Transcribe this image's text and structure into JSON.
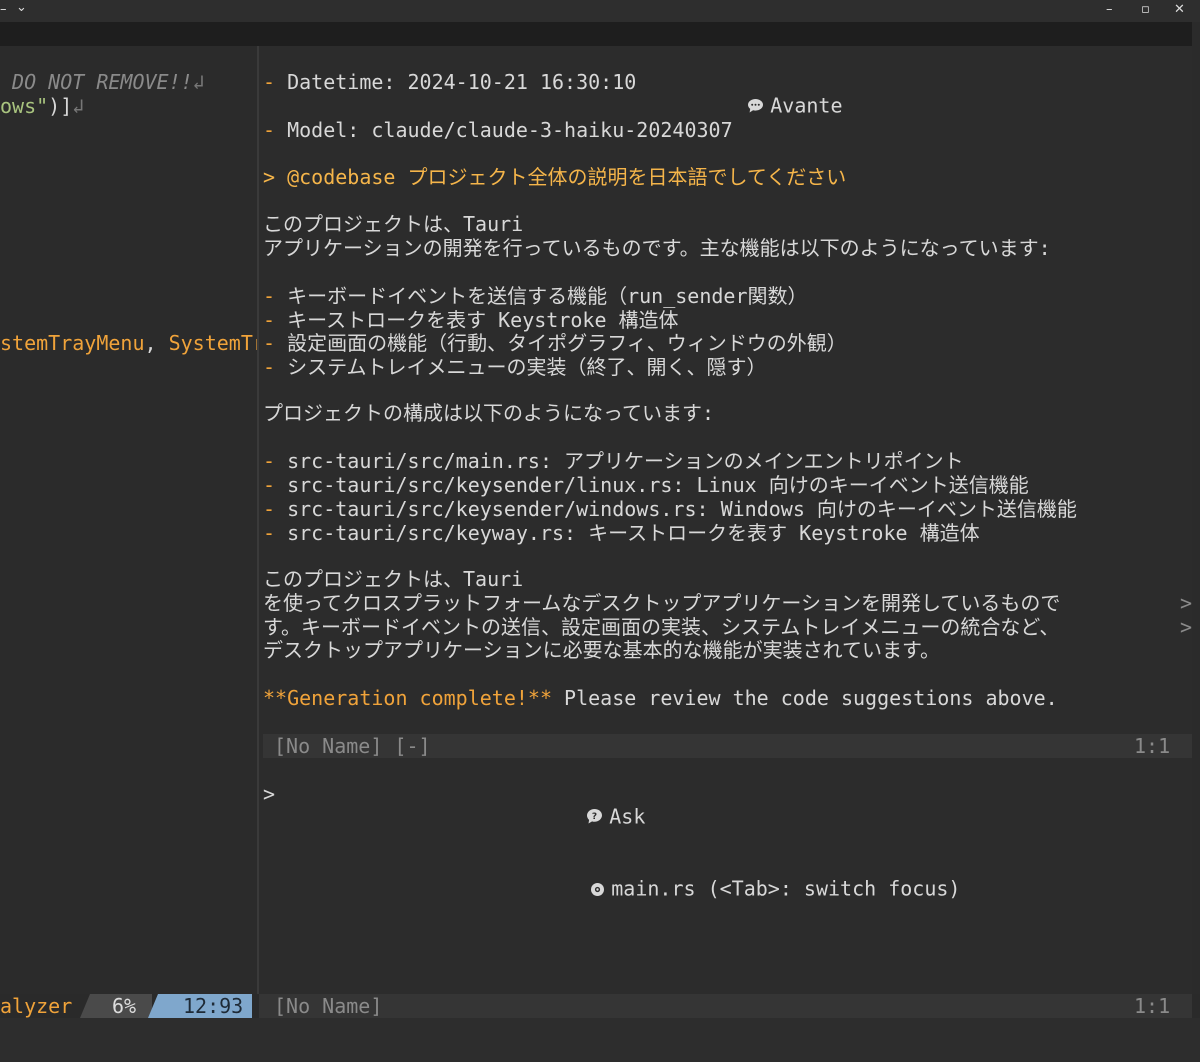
{
  "titlebar": {
    "dropdown_icon": "chevron-down-icon",
    "minimize": "–",
    "maximize": "▫",
    "close": "✕"
  },
  "left_pane": {
    "line1_comment": " DO NOT REMOVE!!",
    "line2_string": "ows\"",
    "line2_rest": ")]",
    "line3_a": "stemTrayMenu",
    "line3_b": ", ",
    "line3_c": "SystemTr",
    "newline_marker": "↲"
  },
  "avante": {
    "title_icon": "chat-bubble-icon",
    "title": "Avante",
    "datetime_bullet": "-",
    "datetime": "Datetime: 2024-10-21 16:30:10",
    "model_bullet": "-",
    "model": "Model: claude/claude-3-haiku-20240307",
    "prompt": "> @codebase プロジェクト全体の説明を日本語でしてください",
    "intro_1": "このプロジェクトは、Tauri",
    "intro_2": "アプリケーションの開発を行っているものです。主な機能は以下のようになっています:",
    "features": [
      "キーボードイベントを送信する機能（run_sender関数）",
      "キーストロークを表す Keystroke 構造体",
      "設定画面の機能（行動、タイポグラフィ、ウィンドウの外観）",
      "システムトレイメニューの実装（終了、開く、隠す）"
    ],
    "structure_heading": "プロジェクトの構成は以下のようになっています:",
    "files": [
      "src-tauri/src/main.rs: アプリケーションのメインエントリポイント",
      "src-tauri/src/keysender/linux.rs: Linux 向けのキーイベント送信機能",
      "src-tauri/src/keysender/windows.rs: Windows 向けのキーイベント送信機能",
      "src-tauri/src/keyway.rs: キーストロークを表す Keystroke 構造体"
    ],
    "summary_1": "このプロジェクトは、Tauri",
    "summary_2": "を使ってクロスプラットフォームなデスクトップアプリケーションを開発しているもので",
    "summary_3": "す。キーボードイベントの送信、設定画面の実装、システムトレイメニューの統合など、",
    "summary_4": "デスクトップアプリケーションに必要な基本的な機能が実装されています。",
    "overflow_marker": ">",
    "complete_bold": "**Generation complete!**",
    "complete_rest": " Please review the code suggestions above.",
    "statusline_left": "[No Name] [-]",
    "statusline_right": "1:1",
    "ask_icon": "question-icon",
    "ask_label": "Ask",
    "file_icon": "settings-file-icon",
    "ask_file": "main.rs (<Tab>: switch focus)",
    "input_prompt": ">"
  },
  "statusbar": {
    "left_text": "alyzer",
    "percent": "6%",
    "position": "12:93",
    "filename": "[No Name]",
    "cursor": "1:1"
  }
}
